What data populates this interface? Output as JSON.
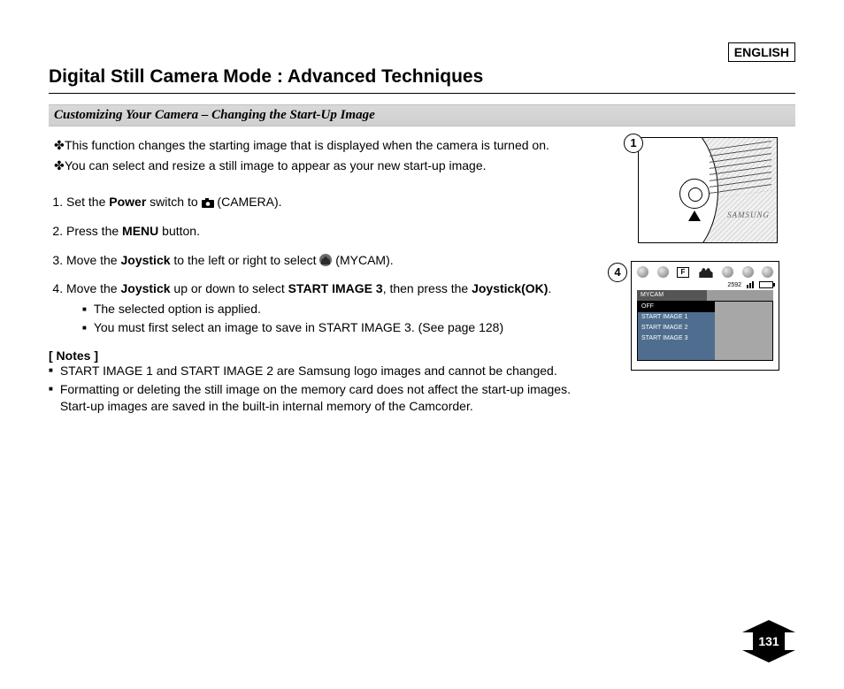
{
  "language_box": "ENGLISH",
  "title": "Digital Still Camera Mode : Advanced Techniques",
  "subtitle": "Customizing Your Camera – Changing the Start-Up Image",
  "intro": [
    "This function changes the starting image that is displayed when the camera is turned on.",
    "You can select and resize a still image to appear as your new start-up image."
  ],
  "steps": {
    "s1_a": "Set the ",
    "s1_b": "Power",
    "s1_c": " switch to ",
    "s1_d": " (CAMERA).",
    "s2_a": "Press the ",
    "s2_b": "MENU",
    "s2_c": " button.",
    "s3_a": "Move the ",
    "s3_b": "Joystick",
    "s3_c": " to the left or right to select  ",
    "s3_d": " (MYCAM).",
    "s4_a": "Move the ",
    "s4_b": "Joystick",
    "s4_c": " up or down to select ",
    "s4_d": "START IMAGE 3",
    "s4_e": ", then press the ",
    "s4_f": "Joystick(OK)",
    "s4_g": ".",
    "s4_sub1": "The selected option is applied.",
    "s4_sub2": "You must first select an image to save in START IMAGE 3. (See page 128)"
  },
  "notes_heading": "[ Notes ]",
  "notes": [
    "START IMAGE 1 and START IMAGE 2 are Samsung logo images and cannot be changed.",
    "Formatting or deleting the still image on the memory card does not affect the start-up images. Start-up images are saved in the built-in internal memory of the Camcorder."
  ],
  "fig1": {
    "badge": "1",
    "brand": "SAMSUNG"
  },
  "fig4": {
    "badge": "4",
    "resolution": "2592",
    "f_label": "F",
    "tab": "MYCAM",
    "menu": [
      "OFF",
      "START IMAGE 1",
      "START IMAGE 2",
      "START IMAGE 3"
    ],
    "selected_index": 0
  },
  "page_number": "131"
}
